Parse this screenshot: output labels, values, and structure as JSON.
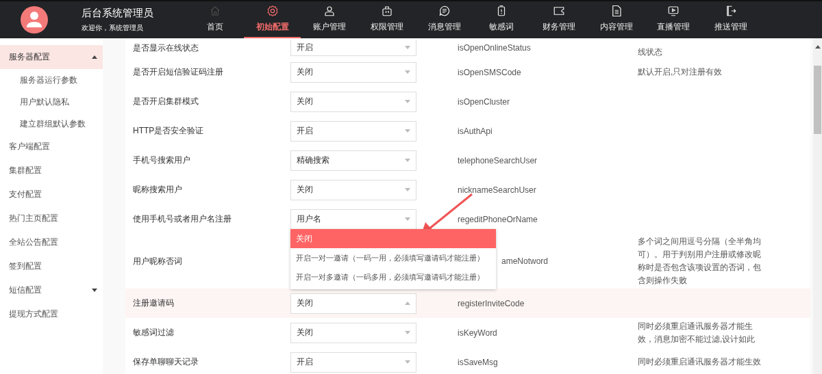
{
  "header": {
    "title": "后台系统管理员",
    "subtitle": "欢迎你，系统管理员"
  },
  "nav": [
    {
      "label": "首页",
      "kind": "home",
      "selected": false,
      "dim": true
    },
    {
      "label": "初始配置",
      "kind": "gear",
      "selected": true,
      "dim": false
    },
    {
      "label": "账户管理",
      "kind": "user",
      "selected": false,
      "dim": false
    },
    {
      "label": "权限管理",
      "kind": "lock",
      "selected": false,
      "dim": false
    },
    {
      "label": "消息管理",
      "kind": "chat",
      "selected": false,
      "dim": false
    },
    {
      "label": "敏感词",
      "kind": "alert",
      "selected": false,
      "dim": false
    },
    {
      "label": "财务管理",
      "kind": "wallet",
      "selected": false,
      "dim": false
    },
    {
      "label": "内容管理",
      "kind": "doc",
      "selected": false,
      "dim": false
    },
    {
      "label": "直播管理",
      "kind": "play",
      "selected": false,
      "dim": false
    },
    {
      "label": "推送管理",
      "kind": "exit",
      "selected": false,
      "dim": false
    }
  ],
  "sidebar": {
    "items": [
      {
        "label": "服务器配置",
        "selected": true,
        "expanded": true,
        "children": [
          {
            "label": "服务器运行参数",
            "selected": false
          },
          {
            "label": "用户默认隐私",
            "selected": false
          },
          {
            "label": "建立群组默认参数",
            "selected": false
          }
        ]
      },
      {
        "label": "客户端配置",
        "selected": false
      },
      {
        "label": "集群配置",
        "selected": false
      },
      {
        "label": "支付配置",
        "selected": false
      },
      {
        "label": "热门主页配置",
        "selected": false
      },
      {
        "label": "全站公告配置",
        "selected": false
      },
      {
        "label": "签到配置",
        "selected": false
      },
      {
        "label": "短信配置",
        "selected": false,
        "expanded": false
      },
      {
        "label": "提现方式配置",
        "selected": false
      }
    ]
  },
  "rows": [
    {
      "label": "是否显示在线状态",
      "value": "开启",
      "key": "isOpenOnlineStatus",
      "description": "线状态",
      "cut_top": true
    },
    {
      "label": "是否开启短信验证码注册",
      "value": "关闭",
      "key": "isOpenSMSCode",
      "description": "默认开启,只对注册有效"
    },
    {
      "label": "是否开启集群模式",
      "value": "关闭",
      "key": "isOpenCluster"
    },
    {
      "label": "HTTP是否安全验证",
      "value": "开启",
      "key": "isAuthApi"
    },
    {
      "label": "手机号搜索用户",
      "value": "精确搜索",
      "key": "telephoneSearchUser"
    },
    {
      "label": "昵称搜索用户",
      "value": "关闭",
      "key": "nicknameSearchUser"
    },
    {
      "label": "使用手机号或者用户名注册",
      "value": "用户名",
      "key": "regeditPhoneOrName"
    },
    {
      "label": "用户昵称否词",
      "key": "ameNotword",
      "key_covered": true,
      "description": "多个词之间用逗号分隔（全半角均可）。用于判别用户注册或修改昵称时是否包含该项设置的否词，包含则操作失败"
    },
    {
      "label": "注册邀请码",
      "value": "关闭",
      "key": "registerInviteCode",
      "expanded": true,
      "options": [
        {
          "label": "关闭",
          "selected": true
        },
        {
          "label": "开启一对一邀请（一码一用，必须填写邀请码才能注册）",
          "selected": false
        },
        {
          "label": "开启一对多邀请（一码多用，必须填写邀请码才能注册）",
          "selected": false
        }
      ]
    },
    {
      "label": "敏感词过滤",
      "value": "关闭",
      "key": "isKeyWord",
      "description": "同时必须重启通讯服务器才能生效，消息加密不能过滤,设计如此"
    },
    {
      "label": "保存单聊聊天记录",
      "value": "开启",
      "key": "isSaveMsg",
      "description": "同时必须重启通讯服务器才能生效"
    }
  ],
  "annotation_arrow": true
}
